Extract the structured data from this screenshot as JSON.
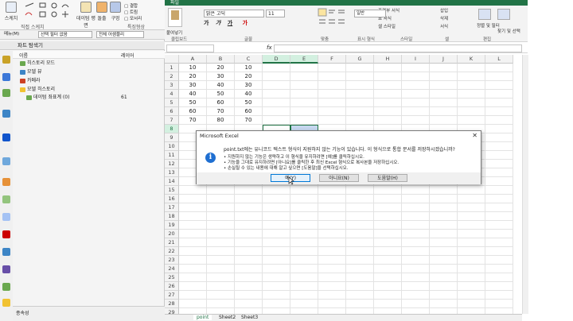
{
  "cad": {
    "ribbon": [
      {
        "label": "스케치"
      },
      {
        "label": "데이텀 평면"
      },
      {
        "label": "돌출"
      },
      {
        "label": "구멍"
      }
    ],
    "ribbon_groups": {
      "direct_sketch": "직접 스케치",
      "feature": "특징형상"
    },
    "filters": {
      "menu": "메뉴(M)",
      "select_filter": "선택 필터 없음",
      "assembly": "전체 어셈블리"
    },
    "navigator_title": "파트 탐색기",
    "columns": {
      "name": "이름",
      "layer": "레이어"
    },
    "tree": [
      {
        "label": "히스토리 모드",
        "layer": ""
      },
      {
        "label": "모델 뷰",
        "layer": ""
      },
      {
        "label": "카메라",
        "layer": ""
      },
      {
        "label": "모델 히스토리",
        "layer": ""
      },
      {
        "label": "데이텀 좌표계 (0)",
        "layer": "61"
      }
    ],
    "bottom": "종속성"
  },
  "excel": {
    "ribbon": {
      "file_tab": "파일",
      "font": "맑은 고딕",
      "font_size": "11",
      "number_format": "일반",
      "clipboard": "클립보드",
      "font_group": "글꼴",
      "align_group": "맞춤",
      "number_group": "표시 형식",
      "style_group": "스타일",
      "cells_group": "셀",
      "edit_group": "편집",
      "paste": "붙여넣기",
      "cond_format": "조건부 서식",
      "table_format": "표 서식",
      "cell_style": "셀 스타일",
      "insert": "삽입",
      "delete": "삭제",
      "format": "서식",
      "sort": "정렬 및 필터",
      "find": "찾기 및 선택",
      "fx": "fx"
    },
    "columns": [
      "A",
      "B",
      "C",
      "D",
      "E",
      "F",
      "G",
      "H",
      "I",
      "J",
      "K",
      "L"
    ],
    "rows": [
      "1",
      "2",
      "3",
      "4",
      "5",
      "6",
      "7",
      "8",
      "9",
      "10",
      "11",
      "12",
      "13",
      "14",
      "15",
      "16",
      "17",
      "18",
      "19",
      "20",
      "21",
      "22",
      "23",
      "24",
      "25",
      "26",
      "27",
      "28",
      "29"
    ],
    "data": [
      [
        "10",
        "20",
        "10"
      ],
      [
        "20",
        "30",
        "20"
      ],
      [
        "30",
        "40",
        "30"
      ],
      [
        "40",
        "50",
        "40"
      ],
      [
        "50",
        "60",
        "50"
      ],
      [
        "60",
        "70",
        "60"
      ],
      [
        "70",
        "80",
        "70"
      ]
    ],
    "sheets": [
      "point",
      "Sheet2",
      "Sheet3"
    ]
  },
  "dialog": {
    "title": "Microsoft Excel",
    "close": "✕",
    "message": "point.txt에는 유니코드 텍스트 형식이 지원하지 않는 기능이 있습니다. 이 형식으로 통합 문서를 저장하시겠습니까?",
    "bullets": [
      "• 지원하지 않는 기능은 생략하고 이 형식을 유지하려면 [예]를 클릭하십시오.",
      "• 기능을 그대로 유지하려면 [아니요]를 클릭한 후 최신 Excel 형식으로 복사본을 저장하십시오.",
      "• 손실될 수 있는 내용에 대해 알고 싶으면 [도움말]을 선택하십시오."
    ],
    "yes": "예(Y)",
    "no": "아니요(N)",
    "help": "도움말(H)"
  },
  "colors": {
    "excel_green": "#217346",
    "dialog_accent": "#0078d7",
    "info_icon": "#1f6fd1"
  }
}
